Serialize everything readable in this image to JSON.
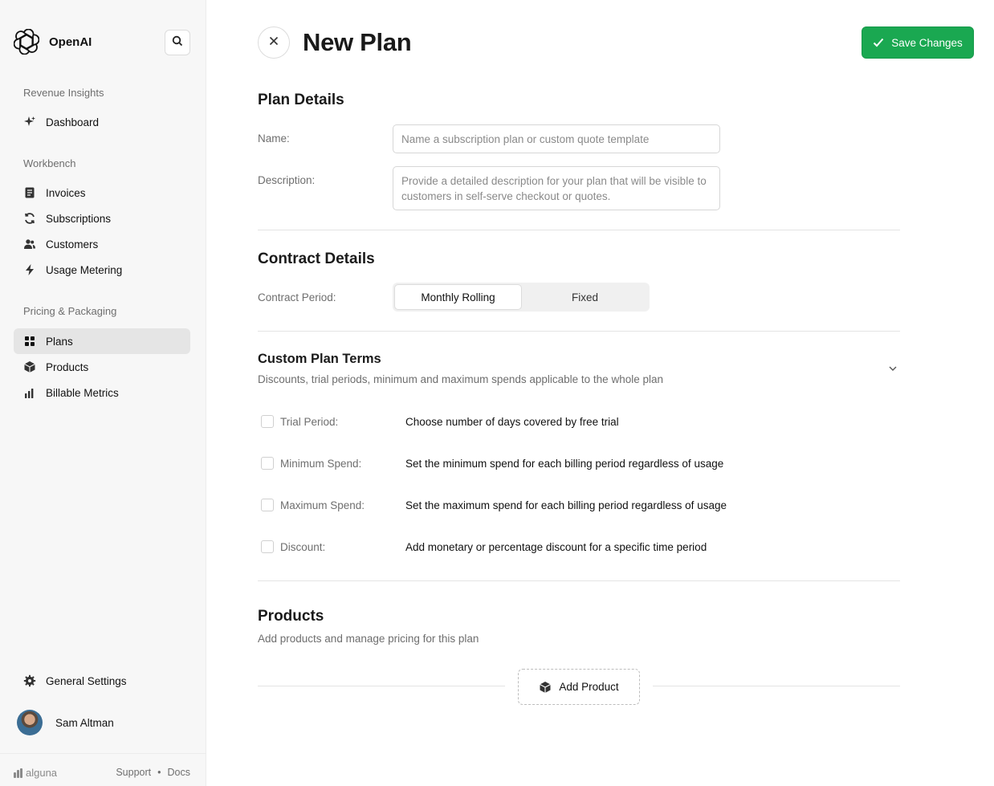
{
  "sidebar": {
    "brand_name": "OpenAI",
    "sections": [
      {
        "heading": "Revenue Insights",
        "items": [
          {
            "label": "Dashboard",
            "icon": "sparkle-icon"
          }
        ]
      },
      {
        "heading": "Workbench",
        "items": [
          {
            "label": "Invoices",
            "icon": "invoice-icon"
          },
          {
            "label": "Subscriptions",
            "icon": "refresh-icon"
          },
          {
            "label": "Customers",
            "icon": "users-icon"
          },
          {
            "label": "Usage Metering",
            "icon": "bolt-icon"
          }
        ]
      },
      {
        "heading": "Pricing & Packaging",
        "items": [
          {
            "label": "Plans",
            "icon": "grid-icon",
            "active": true
          },
          {
            "label": "Products",
            "icon": "box-icon"
          },
          {
            "label": "Billable Metrics",
            "icon": "bar-chart-icon"
          }
        ]
      }
    ],
    "settings_label": "General Settings",
    "user_name": "Sam Altman",
    "footer": {
      "brand": "alguna",
      "support": "Support",
      "separator": "•",
      "docs": "Docs"
    }
  },
  "header": {
    "title": "New Plan",
    "save_label": "Save Changes"
  },
  "plan_details": {
    "title": "Plan Details",
    "name_label": "Name:",
    "name_placeholder": "Name a subscription plan or custom quote template",
    "description_label": "Description:",
    "description_placeholder": "Provide a detailed description for your plan that will be visible to customers in self-serve checkout or quotes."
  },
  "contract_details": {
    "title": "Contract Details",
    "period_label": "Contract Period:",
    "options": [
      "Monthly Rolling",
      "Fixed"
    ],
    "selected": "Monthly Rolling"
  },
  "custom_terms": {
    "title": "Custom Plan Terms",
    "subtitle": "Discounts, trial periods, minimum and maximum spends applicable to the whole plan",
    "rows": [
      {
        "label": "Trial Period:",
        "description": "Choose number of days covered by free trial",
        "checked": false
      },
      {
        "label": "Minimum Spend:",
        "description": "Set the minimum spend for each billing period regardless of usage",
        "checked": false
      },
      {
        "label": "Maximum Spend:",
        "description": "Set the maximum spend for each billing period regardless of usage",
        "checked": false
      },
      {
        "label": "Discount:",
        "description": "Add monetary or percentage discount for a specific time period",
        "checked": false
      }
    ]
  },
  "products": {
    "title": "Products",
    "subtitle": "Add products and manage pricing for this plan",
    "add_label": "Add Product"
  },
  "colors": {
    "accent": "#1aa851",
    "sidebar_bg": "#f7f7f7",
    "active_bg": "#e5e5e5"
  }
}
